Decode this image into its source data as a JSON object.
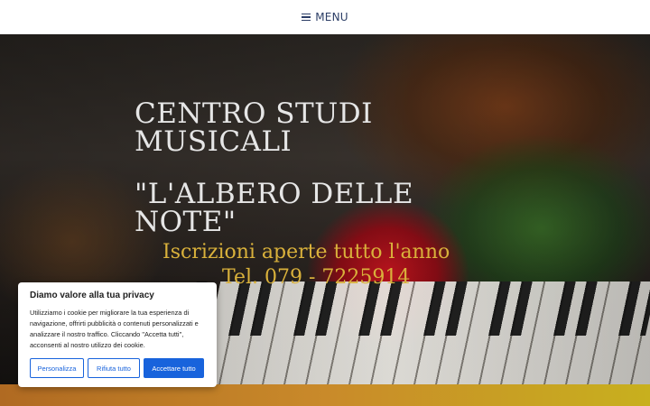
{
  "nav": {
    "menu_label": "MENU",
    "menu_icon": "hamburger-icon"
  },
  "hero": {
    "title_line1": "CENTRO STUDI MUSICALI",
    "title_line2": "\"L'ALBERO DELLE NOTE\"",
    "subtitle_line1": "Iscrizioni aperte tutto l'anno",
    "subtitle_line2": "Tel. 079 - 7225914"
  },
  "cookie_banner": {
    "title": "Diamo valore alla tua privacy",
    "text": "Utilizziamo i cookie per migliorare la tua esperienza di navigazione, offrirti pubblicità o contenuti personalizzati e analizzare il nostro traffico. Cliccando \"Accetta tutti\", acconsenti al nostro utilizzo dei cookie.",
    "customize_label": "Personalizza",
    "reject_label": "Rifiuta tutto",
    "accept_label": "Accettare tutto"
  },
  "colors": {
    "menu_text": "#2c3e66",
    "hero_title": "#e6e6e6",
    "hero_subtitle": "#d9b13b",
    "button_blue": "#1863dc"
  }
}
